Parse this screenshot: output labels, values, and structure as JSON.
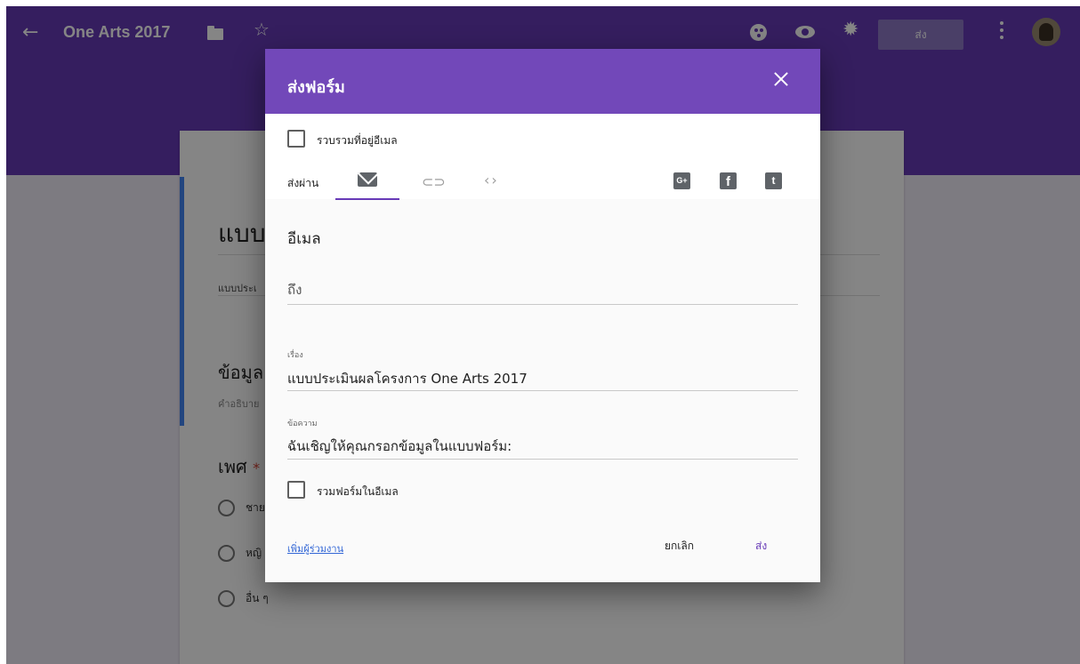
{
  "app": {
    "form_title": "One Arts 2017",
    "send_button_label": "ส่ง"
  },
  "form": {
    "title_partial": "แบบ",
    "description_partial": "แบบประเ",
    "section_title_partial": "ข้อมูล",
    "section_desc_partial": "คำอธิบาย",
    "question_partial": "เพศ",
    "required_mark": "*",
    "options": [
      "ชาย",
      "หญิ",
      "อื่น ๆ"
    ]
  },
  "dialog": {
    "title": "ส่งฟอร์ม",
    "collect_emails_label": "รวบรวมที่อยู่อีเมล",
    "send_via_label": "ส่งผ่าน",
    "tabs": [
      "email",
      "link",
      "embed"
    ],
    "social": {
      "google_plus": "G+",
      "facebook": "f",
      "twitter": "t"
    },
    "section_title": "อีเมล",
    "to_placeholder": "ถึง",
    "subject_label": "เรื่อง",
    "subject_value": "แบบประเมินผลโครงการ One Arts 2017",
    "message_label": "ข้อความ",
    "message_value": "ฉันเชิญให้คุณกรอกข้อมูลในแบบฟอร์ม:",
    "include_form_label": "รวมฟอร์มในอีเมล",
    "add_collaborators_label": "เพิ่มผู้ร่วมงาน",
    "cancel_label": "ยกเลิก",
    "send_label": "ส่ง"
  },
  "colors": {
    "header_purple": "#673ab7",
    "dialog_header": "#7248b9",
    "accent_underline": "#673ab7",
    "link_blue": "#3367d6"
  }
}
